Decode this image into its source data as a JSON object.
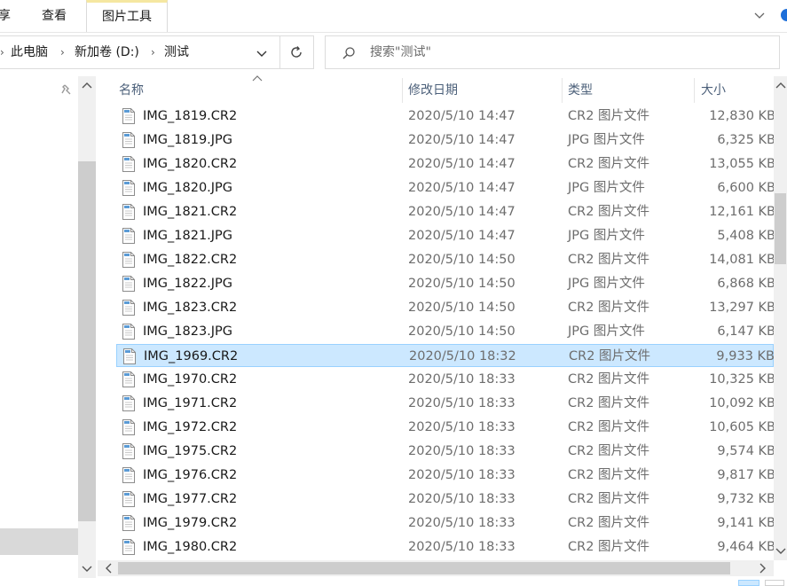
{
  "ribbon": {
    "tab_share": "享",
    "tab_view": "查看",
    "tab_picture_tools": "图片工具"
  },
  "address": {
    "crumbs": [
      "此电脑",
      "新加卷 (D:)",
      "测试"
    ]
  },
  "search": {
    "placeholder": "搜索\"测试\""
  },
  "columns": {
    "name": "名称",
    "date": "修改日期",
    "type": "类型",
    "size": "大小"
  },
  "files": [
    {
      "name": "IMG_1819.CR2",
      "date": "2020/5/10 14:47",
      "type": "CR2 图片文件",
      "size": "12,830 KB"
    },
    {
      "name": "IMG_1819.JPG",
      "date": "2020/5/10 14:47",
      "type": "JPG 图片文件",
      "size": "6,325 KB"
    },
    {
      "name": "IMG_1820.CR2",
      "date": "2020/5/10 14:47",
      "type": "CR2 图片文件",
      "size": "13,055 KB"
    },
    {
      "name": "IMG_1820.JPG",
      "date": "2020/5/10 14:47",
      "type": "JPG 图片文件",
      "size": "6,600 KB"
    },
    {
      "name": "IMG_1821.CR2",
      "date": "2020/5/10 14:47",
      "type": "CR2 图片文件",
      "size": "12,161 KB"
    },
    {
      "name": "IMG_1821.JPG",
      "date": "2020/5/10 14:47",
      "type": "JPG 图片文件",
      "size": "5,408 KB"
    },
    {
      "name": "IMG_1822.CR2",
      "date": "2020/5/10 14:50",
      "type": "CR2 图片文件",
      "size": "14,081 KB"
    },
    {
      "name": "IMG_1822.JPG",
      "date": "2020/5/10 14:50",
      "type": "JPG 图片文件",
      "size": "6,868 KB"
    },
    {
      "name": "IMG_1823.CR2",
      "date": "2020/5/10 14:50",
      "type": "CR2 图片文件",
      "size": "13,297 KB"
    },
    {
      "name": "IMG_1823.JPG",
      "date": "2020/5/10 14:50",
      "type": "JPG 图片文件",
      "size": "6,147 KB"
    },
    {
      "name": "IMG_1969.CR2",
      "date": "2020/5/10 18:32",
      "type": "CR2 图片文件",
      "size": "9,933 KB"
    },
    {
      "name": "IMG_1970.CR2",
      "date": "2020/5/10 18:33",
      "type": "CR2 图片文件",
      "size": "10,325 KB"
    },
    {
      "name": "IMG_1971.CR2",
      "date": "2020/5/10 18:33",
      "type": "CR2 图片文件",
      "size": "10,092 KB"
    },
    {
      "name": "IMG_1972.CR2",
      "date": "2020/5/10 18:33",
      "type": "CR2 图片文件",
      "size": "10,605 KB"
    },
    {
      "name": "IMG_1975.CR2",
      "date": "2020/5/10 18:33",
      "type": "CR2 图片文件",
      "size": "9,574 KB"
    },
    {
      "name": "IMG_1976.CR2",
      "date": "2020/5/10 18:33",
      "type": "CR2 图片文件",
      "size": "9,817 KB"
    },
    {
      "name": "IMG_1977.CR2",
      "date": "2020/5/10 18:33",
      "type": "CR2 图片文件",
      "size": "9,732 KB"
    },
    {
      "name": "IMG_1979.CR2",
      "date": "2020/5/10 18:33",
      "type": "CR2 图片文件",
      "size": "9,141 KB"
    },
    {
      "name": "IMG_1980.CR2",
      "date": "2020/5/10 18:33",
      "type": "CR2 图片文件",
      "size": "9,464 KB"
    }
  ],
  "selected_file": "IMG_1969.CR2",
  "colors": {
    "selection_bg": "#cce8ff",
    "selection_border": "#99d1ff",
    "header_text": "#4c607a",
    "picture_tools_accent": "#f5e7a1"
  }
}
